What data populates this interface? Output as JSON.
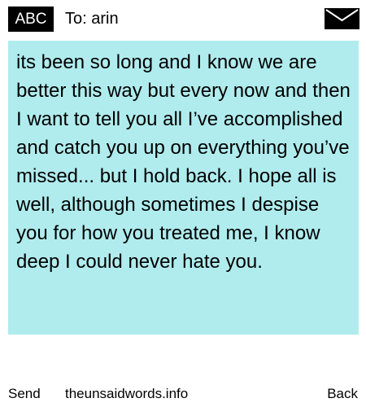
{
  "header": {
    "badge": "ABC",
    "recipient": "To: arin",
    "envelope_icon": "envelope-icon"
  },
  "message": {
    "body": "its been so long and I know we are better this way but every now and then I want to tell you all I’ve accomplished and catch you up on everything you’ve  missed... but I hold back. I hope all is well, although sometimes I despise you for how you treated me, I know deep I could never hate you."
  },
  "footer": {
    "send_label": "Send",
    "site_label": "theunsaidwords.info",
    "back_label": "Back"
  },
  "colors": {
    "message_background": "#b0ecee",
    "badge_background": "#000000",
    "badge_text": "#ffffff"
  }
}
